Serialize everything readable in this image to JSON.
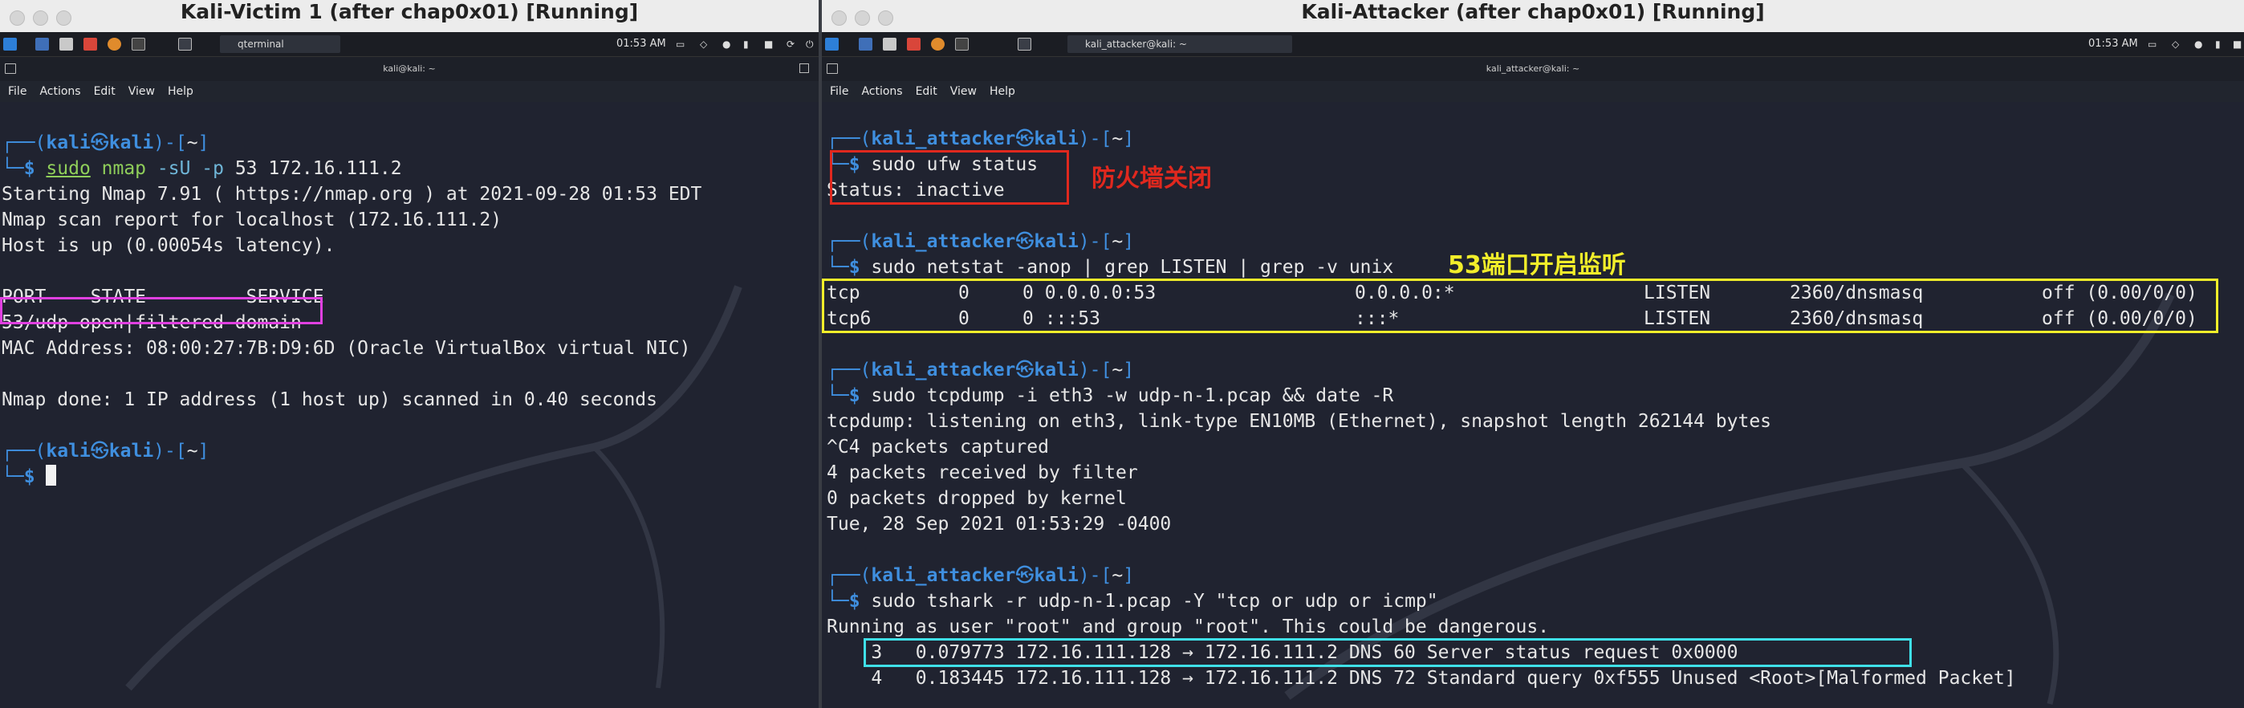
{
  "left_window": {
    "title": "Kali-Victim 1 (after chap0x01) [Running]",
    "taskbar": {
      "task_label": "qterminal",
      "clock": "01:53 AM"
    },
    "terminal_title": "kali@kali: ~",
    "menu": [
      "File",
      "Actions",
      "Edit",
      "View",
      "Help"
    ],
    "prompt": {
      "top": "┌──(",
      "user": "kali",
      "at": "㉿",
      "host": "kali",
      "close": ")-[",
      "path": "~",
      "end": "]",
      "bottom": "└─",
      "dollar": "$ "
    },
    "command1": {
      "sudo": "sudo",
      "rest": " nmap ",
      "flags": "-sU -p",
      "args": " 53 172.16.111.2"
    },
    "output": [
      "Starting Nmap 7.91 ( https://nmap.org ) at 2021-09-28 01:53 EDT",
      "Nmap scan report for localhost (172.16.111.2)",
      "Host is up (0.00054s latency).",
      "",
      "PORT    STATE         SERVICE",
      "53/udp open|filtered domain",
      "MAC Address: 08:00:27:7B:D9:6D (Oracle VirtualBox virtual NIC)",
      "",
      "Nmap done: 1 IP address (1 host up) scanned in 0.40 seconds"
    ],
    "highlight_color": "#e040e0"
  },
  "right_window": {
    "title": "Kali-Attacker (after chap0x01) [Running]",
    "taskbar": {
      "task_label": "kali_attacker@kali: ~",
      "clock": "01:53 AM"
    },
    "terminal_title": "kali_attacker@kali: ~",
    "menu": [
      "File",
      "Actions",
      "Edit",
      "View",
      "Help"
    ],
    "prompt": {
      "top": "┌──(",
      "user": "kali_attacker",
      "at": "㉿",
      "host": "kali",
      "close": ")-[",
      "path": "~",
      "end": "]",
      "bottom": "└─",
      "dollar": "$ "
    },
    "block1": {
      "command": "sudo ufw status",
      "output": "Status: inactive",
      "annotation": "防火墙关闭",
      "box_color": "#e0281e"
    },
    "block2": {
      "command": "sudo netstat -anop | grep LISTEN | grep -v unix",
      "annotation": "53端口开启监听",
      "rows": [
        [
          "tcp",
          "0",
          "0 0.0.0.0:53",
          "0.0.0.0:*",
          "LISTEN",
          "2360/dnsmasq",
          "off (0.00/0/0)"
        ],
        [
          "tcp6",
          "0",
          "0 :::53",
          ":::*",
          "LISTEN",
          "2360/dnsmasq",
          "off (0.00/0/0)"
        ]
      ],
      "box_color": "#f2ee2a"
    },
    "block3": {
      "command": "sudo tcpdump -i eth3 -w udp-n-1.pcap && date -R",
      "output": [
        "tcpdump: listening on eth3, link-type EN10MB (Ethernet), snapshot length 262144 bytes",
        "^C4 packets captured",
        "4 packets received by filter",
        "0 packets dropped by kernel",
        "Tue, 28 Sep 2021 01:53:29 -0400"
      ]
    },
    "block4": {
      "command": "sudo tshark -r udp-n-1.pcap -Y \"tcp or udp or icmp\"",
      "output": [
        "Running as user \"root\" and group \"root\". This could be dangerous.",
        "    3   0.079773 172.16.111.128 → 172.16.111.2 DNS 60 Server status request 0x0000",
        "    4   0.183445 172.16.111.128 → 172.16.111.2 DNS 72 Standard query 0xf555 Unused <Root>[Malformed Packet]"
      ],
      "box_color": "#3fe0e8"
    }
  }
}
